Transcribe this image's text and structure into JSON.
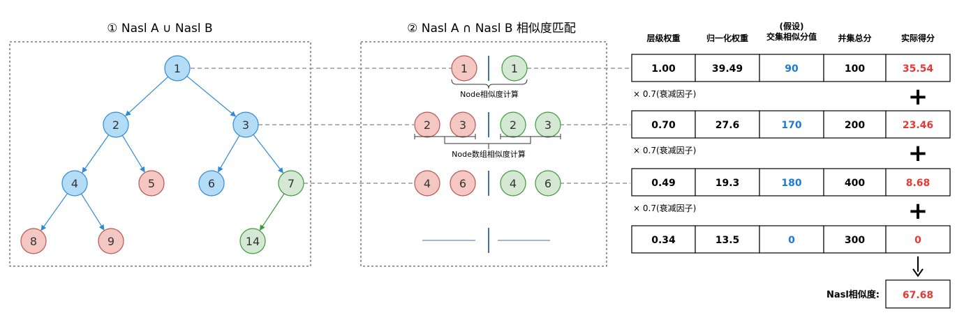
{
  "section1": {
    "title": "① Nasl A ∪ Nasl B"
  },
  "section2": {
    "title": "② Nasl A ∩ Nasl B 相似度匹配"
  },
  "colors": {
    "blue_fill": "#b3dcf7",
    "blue_stroke": "#2f8ad8",
    "red_fill": "#f4c7c3",
    "red_stroke": "#b85450",
    "green_fill": "#d5e8d4",
    "green_stroke": "#3a9a3a",
    "edge_blue": "#2f8ad8",
    "edge_green": "#3a9a3a",
    "value_blue": "#1e7ad6",
    "value_red": "#e53935"
  },
  "tree": {
    "nodes": [
      {
        "id": "n1",
        "label": "1",
        "color": "blue"
      },
      {
        "id": "n2",
        "label": "2",
        "color": "blue"
      },
      {
        "id": "n3",
        "label": "3",
        "color": "blue"
      },
      {
        "id": "n4",
        "label": "4",
        "color": "blue"
      },
      {
        "id": "n5",
        "label": "5",
        "color": "red"
      },
      {
        "id": "n6",
        "label": "6",
        "color": "blue"
      },
      {
        "id": "n7",
        "label": "7",
        "color": "green"
      },
      {
        "id": "n8",
        "label": "8",
        "color": "red"
      },
      {
        "id": "n9",
        "label": "9",
        "color": "red"
      },
      {
        "id": "n14",
        "label": "14",
        "color": "green"
      }
    ],
    "edges": [
      {
        "from": "n1",
        "to": "n2",
        "color": "blue"
      },
      {
        "from": "n1",
        "to": "n3",
        "color": "blue"
      },
      {
        "from": "n2",
        "to": "n4",
        "color": "blue"
      },
      {
        "from": "n2",
        "to": "n5",
        "color": "blue"
      },
      {
        "from": "n3",
        "to": "n6",
        "color": "blue"
      },
      {
        "from": "n3",
        "to": "n7",
        "color": "blue"
      },
      {
        "from": "n4",
        "to": "n8",
        "color": "blue"
      },
      {
        "from": "n4",
        "to": "n9",
        "color": "blue"
      },
      {
        "from": "n7",
        "to": "n14",
        "color": "green"
      }
    ]
  },
  "match": {
    "rows": [
      {
        "left": [
          "1"
        ],
        "right": [
          "1"
        ]
      },
      {
        "left": [
          "2",
          "3"
        ],
        "right": [
          "2",
          "3"
        ]
      },
      {
        "left": [
          "4",
          "6"
        ],
        "right": [
          "4",
          "6"
        ]
      },
      {
        "left": [],
        "right": []
      }
    ],
    "node_sim_label": "Node相似度计算",
    "array_sim_label": "Node数组相似度计算"
  },
  "table": {
    "headers": [
      "层级权重",
      "归一化权重",
      "(假设)\n交集相似分值",
      "并集总分",
      "实际得分"
    ],
    "rows": [
      [
        "1.00",
        "39.49",
        "90",
        "100",
        "35.54"
      ],
      [
        "0.70",
        "27.6",
        "170",
        "200",
        "23.46"
      ],
      [
        "0.49",
        "19.3",
        "180",
        "400",
        "8.68"
      ],
      [
        "0.34",
        "13.5",
        "0",
        "300",
        "0"
      ]
    ],
    "decay_label": "× 0.7(衰减因子)",
    "plus": "+",
    "arrow": "↓",
    "result_label": "Nasl相似度:",
    "result_value": "67.68"
  }
}
